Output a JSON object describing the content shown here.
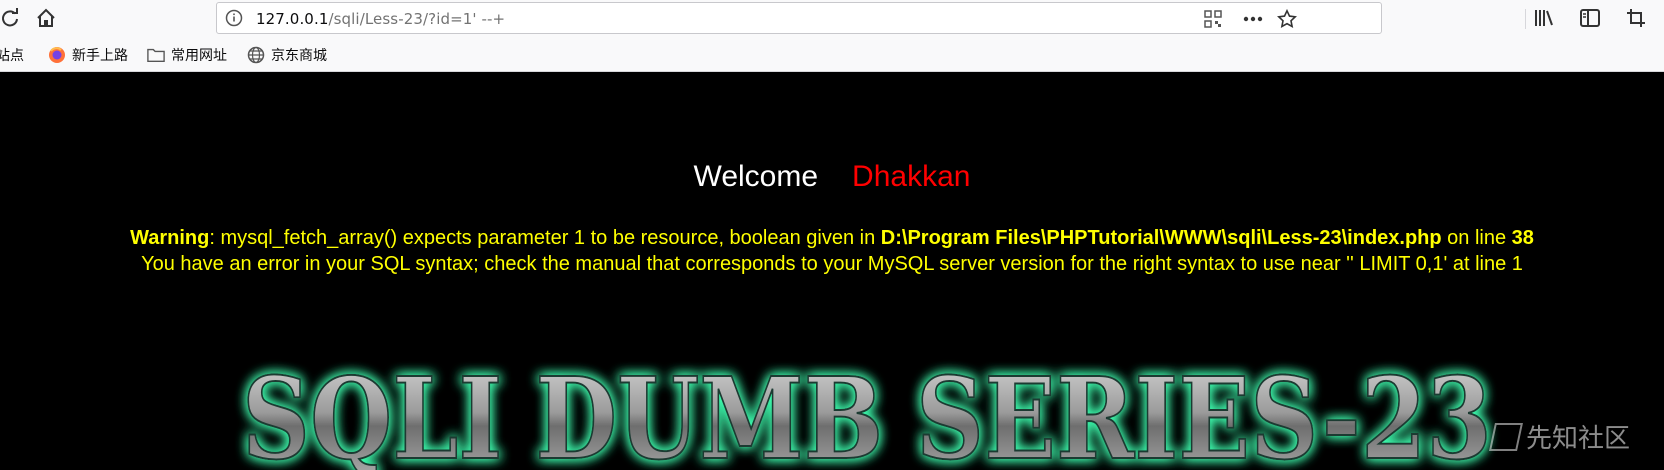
{
  "browser": {
    "url_host": "127.0.0.1",
    "url_path": "/sqli/Less-23/?id=1' --+",
    "bookmarks": [
      {
        "label": "站点",
        "icon": "site-icon"
      },
      {
        "label": "新手上路",
        "icon": "firefox-icon"
      },
      {
        "label": "常用网址",
        "icon": "folder-icon"
      },
      {
        "label": "京东商城",
        "icon": "globe-icon"
      }
    ]
  },
  "page": {
    "welcome": "Welcome",
    "user": "Dhakkan",
    "warning_label": "Warning",
    "warning_text": ": mysql_fetch_array() expects parameter 1 to be resource, boolean given in ",
    "warning_file": "D:\\Program Files\\PHPTutorial\\WWW\\sqli\\Less-23\\index.php",
    "warning_online": " on line ",
    "warning_line": "38",
    "sql_error": "You have an error in your SQL syntax; check the manual that corresponds to your MySQL server version for the right syntax to use near '' LIMIT 0,1' at line 1",
    "banner_text": "SQLI DUMB SERIES-23",
    "watermark": "先知社区"
  },
  "colors": {
    "welcome": "#ffffff",
    "user": "#ff0000",
    "warning": "#ffff00",
    "banner_glow": "#3fffb0"
  }
}
